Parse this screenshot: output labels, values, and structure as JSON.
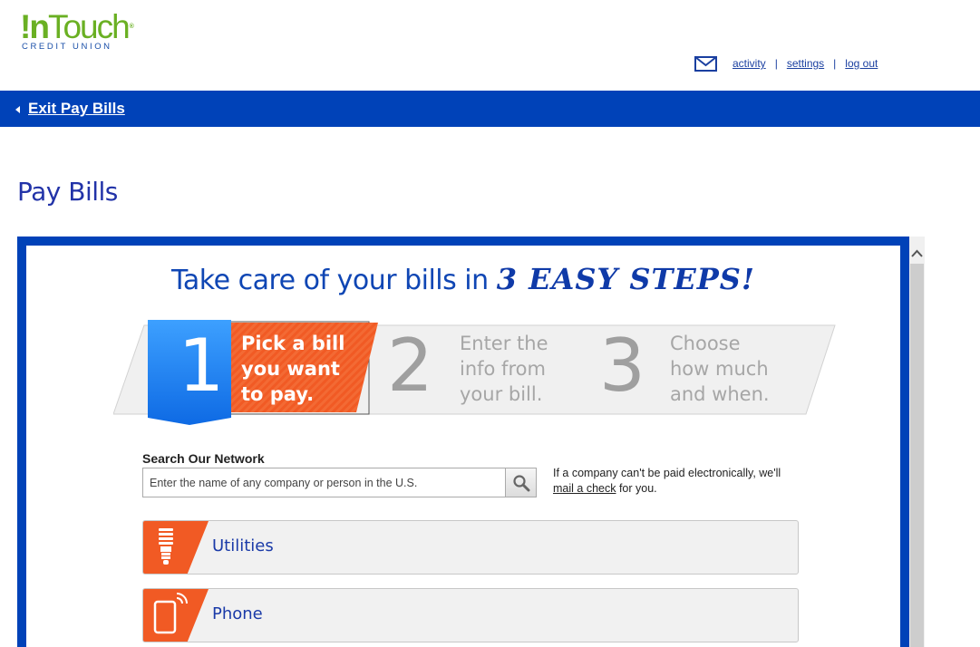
{
  "header": {
    "logo_main_bang": "!",
    "logo_main_n": "n",
    "logo_main_touch": "Touch",
    "logo_reg": "®",
    "logo_sub": "CREDIT UNION",
    "links": {
      "activity": "activity",
      "settings": "settings",
      "logout": "log out"
    },
    "separator": "|"
  },
  "nav": {
    "exit_label": "Exit Pay Bills"
  },
  "page": {
    "title": "Pay Bills"
  },
  "promo": {
    "headline_prefix": "Take care of your bills in",
    "headline_emphasis": "3 EASY STEPS!",
    "steps": [
      {
        "number": "1",
        "line1": "Pick a bill",
        "line2": "you want",
        "line3": "to pay."
      },
      {
        "number": "2",
        "line1": "Enter the",
        "line2": "info from",
        "line3": "your bill."
      },
      {
        "number": "3",
        "line1": "Choose",
        "line2": "how much",
        "line3": "and when."
      }
    ]
  },
  "search": {
    "label": "Search Our Network",
    "placeholder": "Enter the name of any company or person in the U.S.",
    "note_before": "If a company can't be paid electronically, we'll",
    "note_link": "mail a check",
    "note_after": " for you."
  },
  "categories": [
    {
      "label": "Utilities",
      "icon": "lightbulb-icon"
    },
    {
      "label": "Phone",
      "icon": "phone-icon"
    }
  ],
  "colors": {
    "brand_blue": "#0042b8",
    "step_blue": "#1a7ff0",
    "step_orange": "#f15a24",
    "logo_green": "#6ab023"
  }
}
